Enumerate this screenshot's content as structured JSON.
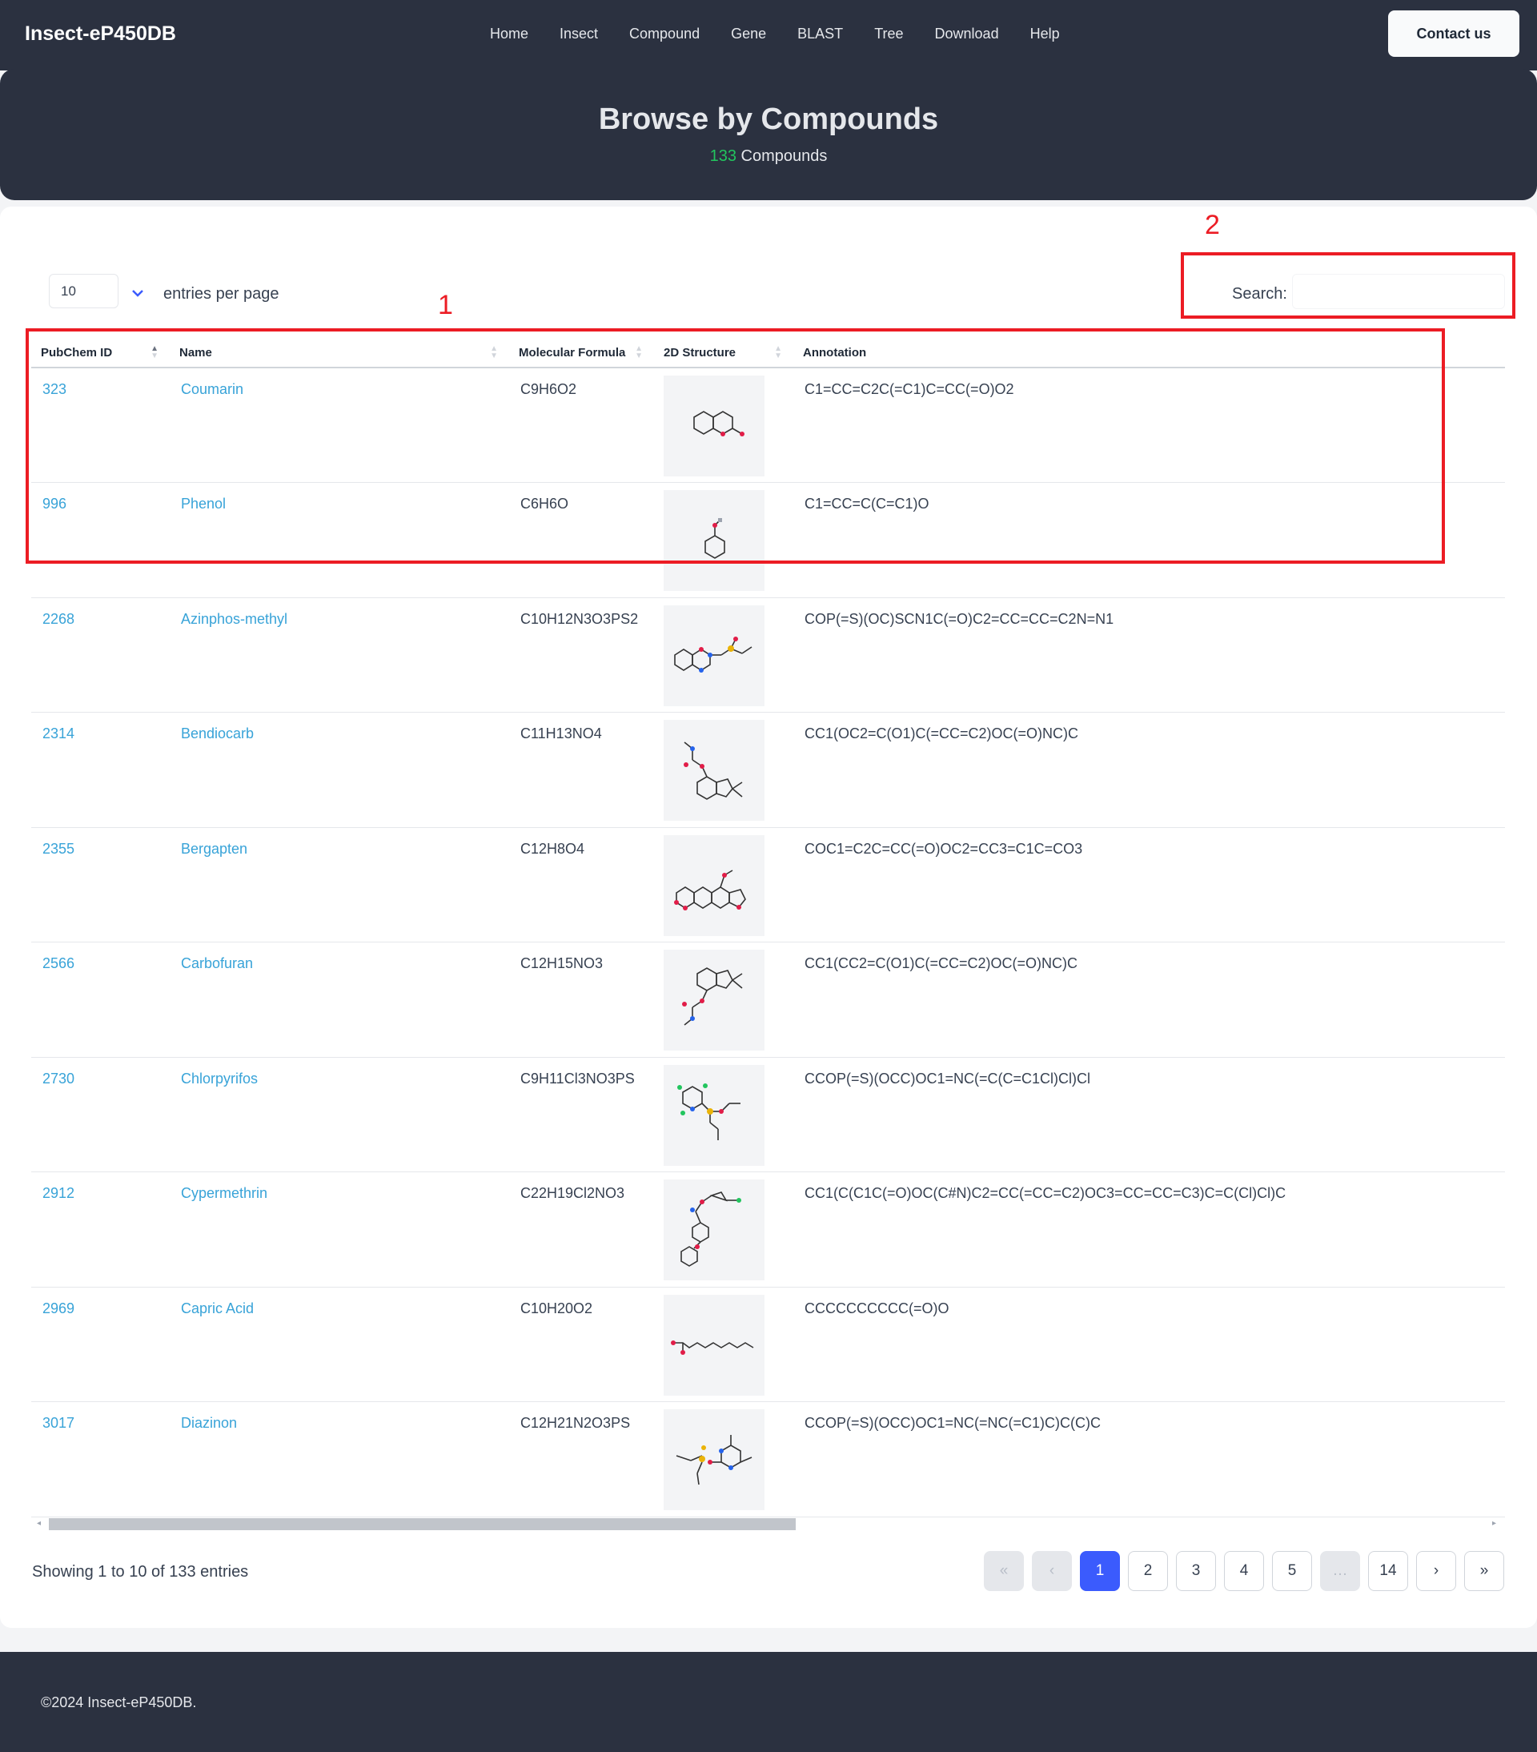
{
  "nav": {
    "brand": "Insect-eP450DB",
    "links": [
      "Home",
      "Insect",
      "Compound",
      "Gene",
      "BLAST",
      "Tree",
      "Download",
      "Help"
    ],
    "contact": "Contact us"
  },
  "hero": {
    "title": "Browse by Compounds",
    "count": "133",
    "count_label": "Compounds"
  },
  "controls": {
    "entries_value": "10",
    "entries_label": "entries per page",
    "search_label": "Search:",
    "search_value": ""
  },
  "table": {
    "headers": [
      "PubChem ID",
      "Name",
      "Molecular Formula",
      "2D Structure",
      "Annotation"
    ],
    "rows": [
      {
        "id": "323",
        "name": "Coumarin",
        "formula": "C9H6O2",
        "annotation": "C1=CC=C2C(=C1)C=CC(=O)O2"
      },
      {
        "id": "996",
        "name": "Phenol",
        "formula": "C6H6O",
        "annotation": "C1=CC=C(C=C1)O"
      },
      {
        "id": "2268",
        "name": "Azinphos-methyl",
        "formula": "C10H12N3O3PS2",
        "annotation": "COP(=S)(OC)SCN1C(=O)C2=CC=CC=C2N=N1"
      },
      {
        "id": "2314",
        "name": "Bendiocarb",
        "formula": "C11H13NO4",
        "annotation": "CC1(OC2=C(O1)C(=CC=C2)OC(=O)NC)C"
      },
      {
        "id": "2355",
        "name": "Bergapten",
        "formula": "C12H8O4",
        "annotation": "COC1=C2C=CC(=O)OC2=CC3=C1C=CO3"
      },
      {
        "id": "2566",
        "name": "Carbofuran",
        "formula": "C12H15NO3",
        "annotation": "CC1(CC2=C(O1)C(=CC=C2)OC(=O)NC)C"
      },
      {
        "id": "2730",
        "name": "Chlorpyrifos",
        "formula": "C9H11Cl3NO3PS",
        "annotation": "CCOP(=S)(OCC)OC1=NC(=C(C=C1Cl)Cl)Cl"
      },
      {
        "id": "2912",
        "name": "Cypermethrin",
        "formula": "C22H19Cl2NO3",
        "annotation": "CC1(C(C1C(=O)OC(C#N)C2=CC(=CC=C2)OC3=CC=CC=C3)C=C(Cl)Cl)C"
      },
      {
        "id": "2969",
        "name": "Capric Acid",
        "formula": "C10H20O2",
        "annotation": "CCCCCCCCCC(=O)O"
      },
      {
        "id": "3017",
        "name": "Diazinon",
        "formula": "C12H21N2O3PS",
        "annotation": "CCOP(=S)(OCC)OC1=NC(=NC(=C1)C)C(C)C"
      }
    ]
  },
  "footer_info": {
    "showing": "Showing 1 to 10 of 133 entries",
    "pages": [
      "«",
      "‹",
      "1",
      "2",
      "3",
      "4",
      "5",
      "…",
      "14",
      "›",
      "»"
    ],
    "copyright": "©2024 Insect-eP450DB."
  },
  "annotations": {
    "box1": "1",
    "box2": "2"
  },
  "colors": {
    "nav_bg": "#2b3140",
    "link": "#38a3d8",
    "count": "#22c55e",
    "active_page": "#3b5bfd",
    "annotation": "#ec1c24"
  }
}
